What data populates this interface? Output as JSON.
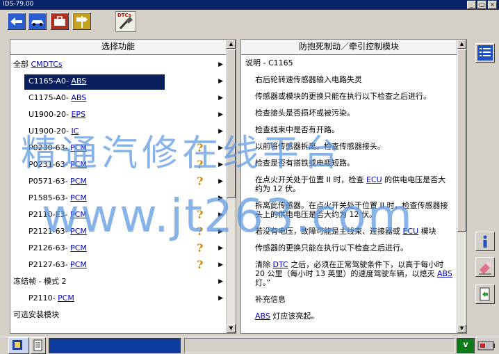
{
  "window": {
    "title": "IDS-79.00",
    "min_glyph": "_",
    "max_glyph": "□",
    "close_glyph": "×"
  },
  "toolbar": {
    "dtc_tab_label": "DTCs",
    "tools": [
      {
        "icon": "back-arrow-icon"
      },
      {
        "icon": "vehicle-icon"
      },
      {
        "icon": "toolbox-icon"
      },
      {
        "icon": "signpost-icon"
      }
    ]
  },
  "left_panel": {
    "header": "选择功能",
    "rows": [
      {
        "prefix": "全部 ",
        "link": "CMDTCs",
        "arrow": "▶",
        "indent": "l0",
        "help": ""
      },
      {
        "prefix": "C1165-A0- ",
        "link": "ABS",
        "arrow": "▶",
        "indent": "l1",
        "help": "",
        "selected": true
      },
      {
        "prefix": "C1175-A0- ",
        "link": "ABS",
        "arrow": "▶",
        "indent": "l1",
        "help": ""
      },
      {
        "prefix": "U1900-20- ",
        "link": "EPS",
        "arrow": "▶",
        "indent": "l1",
        "help": ""
      },
      {
        "prefix": "U1900-20- ",
        "link": "IC",
        "arrow": "▶",
        "indent": "l1",
        "help": ""
      },
      {
        "prefix": "P0230-63- ",
        "link": "PCM",
        "arrow": "▶",
        "indent": "l1",
        "help": "?"
      },
      {
        "prefix": "P0231-63- ",
        "link": "PCM",
        "arrow": "▶",
        "indent": "l1",
        "help": "?"
      },
      {
        "prefix": "P0571-63- ",
        "link": "PCM",
        "arrow": "▶",
        "indent": "l1",
        "help": "?"
      },
      {
        "prefix": "P1585-63- ",
        "link": "PCM",
        "arrow": "▶",
        "indent": "l1",
        "help": ""
      },
      {
        "prefix": "P2110-E3- ",
        "link": "PCM",
        "arrow": "▶",
        "indent": "l1",
        "help": "?"
      },
      {
        "prefix": "P2121-63- ",
        "link": "PCM",
        "arrow": "▶",
        "indent": "l1",
        "help": "?"
      },
      {
        "prefix": "P2126-63- ",
        "link": "PCM",
        "arrow": "▶",
        "indent": "l1",
        "help": "?"
      },
      {
        "prefix": "P2127-63- ",
        "link": "PCM",
        "arrow": "▶",
        "indent": "l1",
        "help": "?"
      },
      {
        "prefix": "冻结帧 - 模式 2",
        "link": "",
        "arrow": "▶",
        "indent": "l0",
        "help": ""
      },
      {
        "prefix": "P2110- ",
        "link": "PCM",
        "arrow": "▶",
        "indent": "l1",
        "help": ""
      },
      {
        "prefix": "可选安装模块",
        "link": "",
        "arrow": "",
        "indent": "l0",
        "help": ""
      }
    ]
  },
  "right_panel": {
    "header": "防抱死制动／牵引控制模块",
    "paras": [
      {
        "indent": false,
        "parts": [
          {
            "t": "说明 - C1165"
          }
        ]
      },
      {
        "indent": true,
        "parts": [
          {
            "t": "右后轮转速传感器输入电路失灵"
          }
        ]
      },
      {
        "indent": true,
        "parts": [
          {
            "t": "传感器或模块的更换只能在执行以下检查之后进行。"
          }
        ]
      },
      {
        "indent": true,
        "parts": [
          {
            "t": "检查接头是否损坏或被污染。"
          }
        ]
      },
      {
        "indent": true,
        "parts": [
          {
            "t": "检查线束中是否有开路。"
          }
        ]
      },
      {
        "indent": true,
        "parts": [
          {
            "t": "以前将传感器拆离，检查传感器接头。"
          }
        ]
      },
      {
        "indent": true,
        "parts": [
          {
            "t": "检查是否有搭铁或电瓶短路。"
          }
        ]
      },
      {
        "indent": true,
        "parts": [
          {
            "t": "在点火开关处于位置 II 时，检查 "
          },
          {
            "t": "ECU",
            "link": true
          },
          {
            "t": " 的供电电压是否大约为 12 伏。"
          }
        ]
      },
      {
        "indent": true,
        "parts": [
          {
            "t": "拆离此传感器。在点火开关处于位置 II 时，检查传感器接头上的供电电压是否大约为 12 伏。"
          }
        ]
      },
      {
        "indent": true,
        "parts": [
          {
            "t": "若没有电压，故障可能是主线束、连接器或 "
          },
          {
            "t": "ECU",
            "link": true
          },
          {
            "t": " 模块"
          }
        ]
      },
      {
        "indent": true,
        "parts": [
          {
            "t": "传感器的更换只能在执行以下检查之后进行。"
          }
        ]
      },
      {
        "indent": true,
        "parts": [
          {
            "t": "清除 "
          },
          {
            "t": "DTC",
            "link": true
          },
          {
            "t": " 之后，必须在正常驾驶条件下，以高于每小时 20 公里（每小时 13 英里）的速度驾驶车辆，以熄灭 "
          },
          {
            "t": "ABS",
            "link": true
          },
          {
            "t": " 灯。”"
          }
        ]
      },
      {
        "indent": true,
        "parts": [
          {
            "t": "补充信息"
          }
        ]
      },
      {
        "indent": true,
        "parts": [
          {
            "t": "ABS",
            "link": true
          },
          {
            "t": " 灯应该亮起。"
          }
        ]
      }
    ]
  },
  "side_buttons": [
    {
      "icon": "list-view-icon"
    },
    {
      "icon": "info-icon"
    },
    {
      "icon": "eraser-icon"
    },
    {
      "icon": "print-icon"
    }
  ],
  "bottom_bar": {
    "voltage_label": "V",
    "icons": [
      "vehicle-info-icon",
      "document-icon",
      "voltage-indicator-icon",
      "battery-icon"
    ]
  },
  "watermark": {
    "line1": "精通汽修在线平台",
    "line2": "www.jt263.com"
  },
  "colors": {
    "selection": "#0a1f5c",
    "link": "#0000cc",
    "watermark": "#5a96e1",
    "help": "#d08a00",
    "voltage_ok": "#0f7a1a"
  }
}
